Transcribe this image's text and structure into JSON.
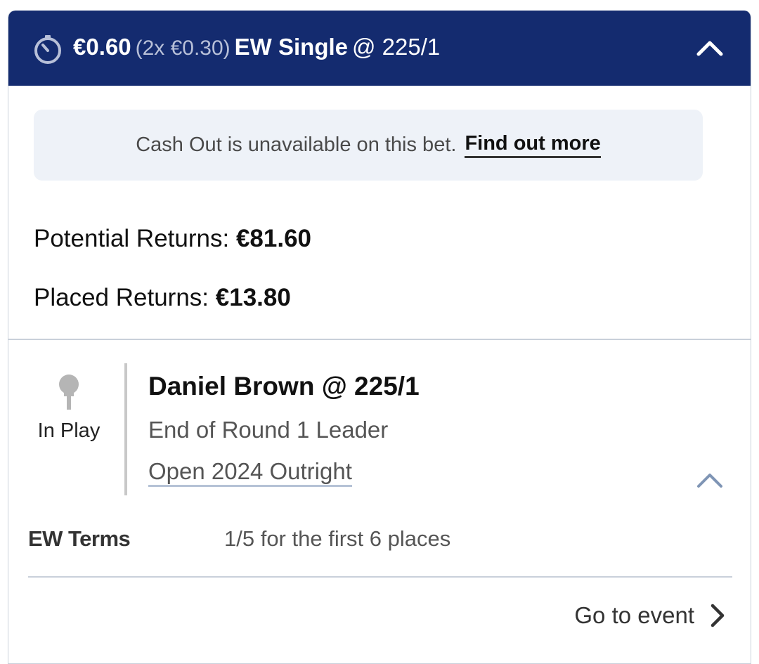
{
  "header": {
    "stake": "€0.60",
    "each_way_stake": "(2x €0.30)",
    "bet_type": "EW Single",
    "odds": "@ 225/1",
    "timer_icon": "stopwatch-icon",
    "collapse_icon": "chevron-up-icon",
    "background_color": "#142b6f"
  },
  "cashout": {
    "message": "Cash Out is unavailable on this bet.",
    "link_label": "Find out more"
  },
  "returns": {
    "potential_label": "Potential Returns:",
    "potential_value": "€81.60",
    "placed_label": "Placed Returns:",
    "placed_value": "€13.80"
  },
  "selection": {
    "status_icon": "golf-tee-icon",
    "status_label": "In Play",
    "name": "Daniel Brown @ 225/1",
    "market": "End of Round 1 Leader",
    "event": "Open 2024 Outright",
    "expand_icon": "chevron-up-icon"
  },
  "ew_terms": {
    "label": "EW Terms",
    "value": "1/5 for the first 6 places"
  },
  "footer": {
    "goto_label": "Go to event",
    "goto_icon": "chevron-right-icon"
  }
}
